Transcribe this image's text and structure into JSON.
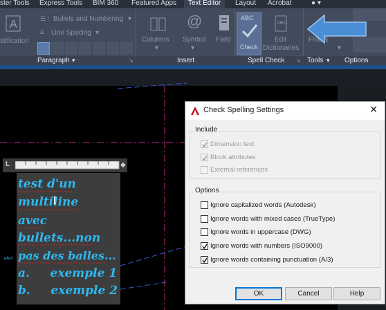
{
  "ribbon": {
    "tabs": [
      "ster Tools",
      "Express Tools",
      "BIM 360",
      "Featured Apps",
      "Text Editor",
      "Layout",
      "Acrobat"
    ],
    "paragraph": {
      "justification_label": "stification",
      "bullets_label": "Bullets and Numbering",
      "line_spacing_label": "Line Spacing",
      "panel_label": "Paragraph"
    },
    "insert": {
      "columns_label": "Columns",
      "symbol_label": "Symbol",
      "field_label": "Field",
      "panel_label": "Insert"
    },
    "spell_check": {
      "spell_label": "Spell Check",
      "edit_dictionaries_label1": "Edit",
      "edit_dictionaries_label2": "Dictionaries",
      "panel_label": "Spell Check",
      "abc_text": "ABC"
    },
    "tools": {
      "find_label1": "Find &",
      "find_label2": "Replace",
      "panel_label": "Tools"
    },
    "options": {
      "panel_label": "Options"
    }
  },
  "mtext": {
    "lines": [
      "test d'un",
      "multiline",
      "avec",
      "bullets...non",
      "pas des balles...",
      "a.     exemple 1",
      "b.     exemple 2"
    ],
    "left_fragment": "elect"
  },
  "dialog": {
    "title": "Check Spelling Settings",
    "include": {
      "title": "Include",
      "items": [
        {
          "label": "Dimension text",
          "checked": true
        },
        {
          "label": "Block attributes",
          "checked": true
        },
        {
          "label": "External references",
          "checked": false
        }
      ]
    },
    "options": {
      "title": "Options",
      "items": [
        {
          "label": "Ignore capitalized words (Autodesk)",
          "checked": false
        },
        {
          "label": "Ignore words with mixed cases (TrueType)",
          "checked": false
        },
        {
          "label": "Ignore words in uppercase (DWG)",
          "checked": false
        },
        {
          "label": "Ignore words with numbers (ISO9000)",
          "checked": true
        },
        {
          "label": "Ignore words containing punctuation (A/3)",
          "checked": true
        }
      ]
    },
    "buttons": {
      "ok": "OK",
      "cancel": "Cancel",
      "help": "Help"
    }
  },
  "colors": {
    "accent_blue": "#2fb8f0",
    "arrow_blue": "#4a8fd6",
    "autocad_red": "#c8102e"
  }
}
